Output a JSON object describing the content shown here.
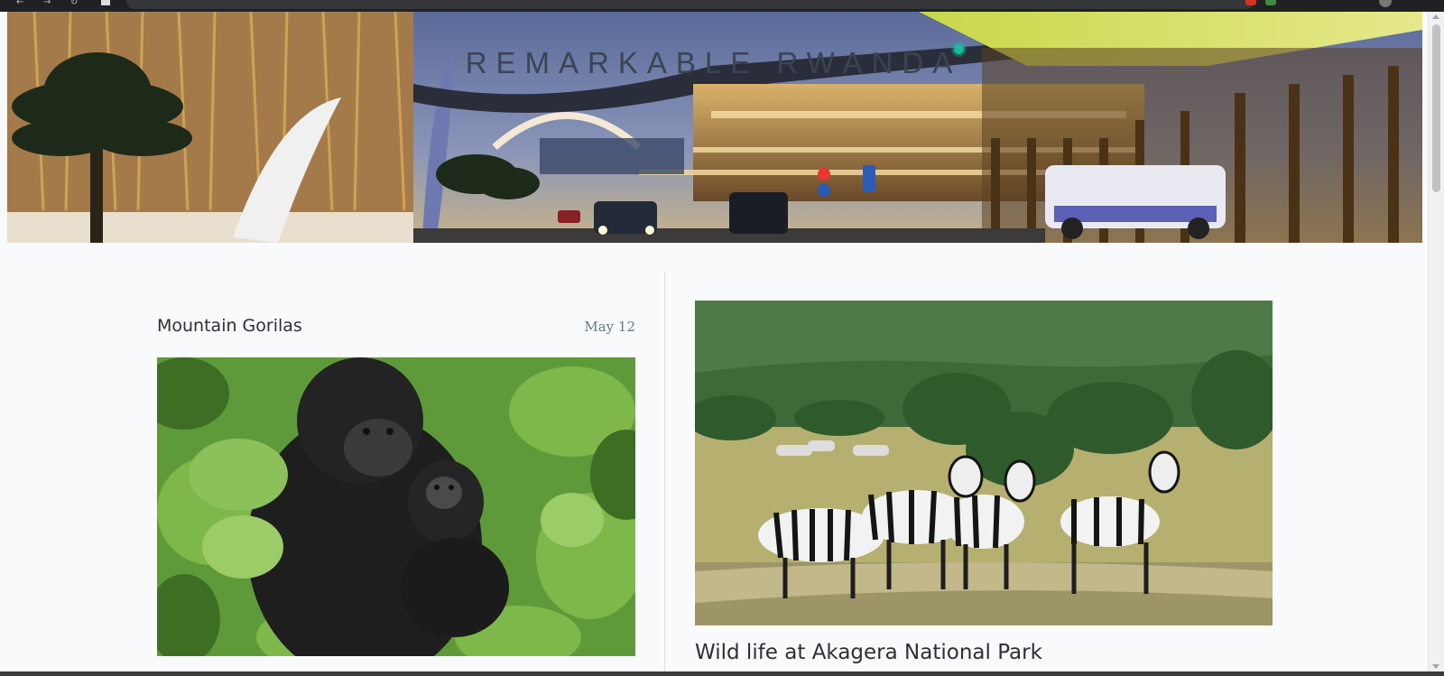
{
  "site": {
    "title": "REMARKABLE RWANDA"
  },
  "hero": {
    "image": "Kigali Convention Centre and Radisson Blu hotel at dusk"
  },
  "posts": [
    {
      "title": "Mountain Gorilas",
      "date": "May 12",
      "image": "Mountain gorilla mother holding baby in foliage"
    },
    {
      "title": "Wild life at Akagera National Park",
      "image": "Zebras grazing in Akagera National Park savanna"
    }
  ],
  "colors": {
    "background": "#f8fafc",
    "title_text": "#3b4452",
    "accent": "#1abc9c",
    "date_text": "#6c7886"
  }
}
